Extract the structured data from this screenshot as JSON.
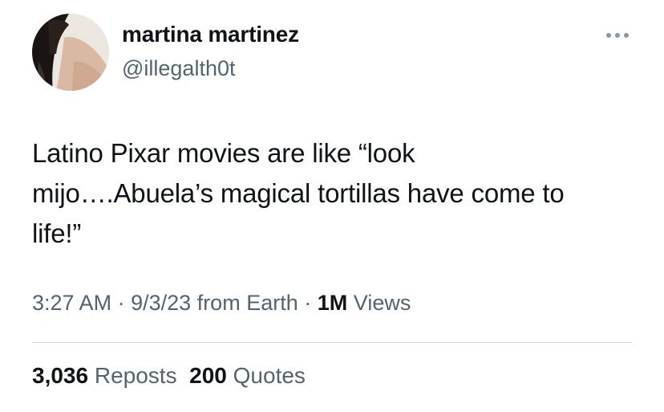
{
  "author": {
    "display_name": "martina martinez",
    "handle": "@illegalth0t",
    "avatar": "profile-photo"
  },
  "more_icon": "more-horizontal-icon",
  "tweet": {
    "text_lines": [
      "Latino Pixar movies are like “look",
      "mijo….Abuela’s magical tortillas have come to",
      "life!”"
    ]
  },
  "meta": {
    "time": "3:27 AM",
    "separator": "·",
    "date": "9/3/23",
    "source": "from Earth",
    "views_count": "1M",
    "views_label": "Views"
  },
  "stats": {
    "reposts_count": "3,036",
    "reposts_label": "Reposts",
    "quotes_count": "200",
    "quotes_label": "Quotes"
  },
  "colors": {
    "primary_text": "#0f1419",
    "secondary_text": "#536471",
    "divider": "#cfd9de"
  }
}
